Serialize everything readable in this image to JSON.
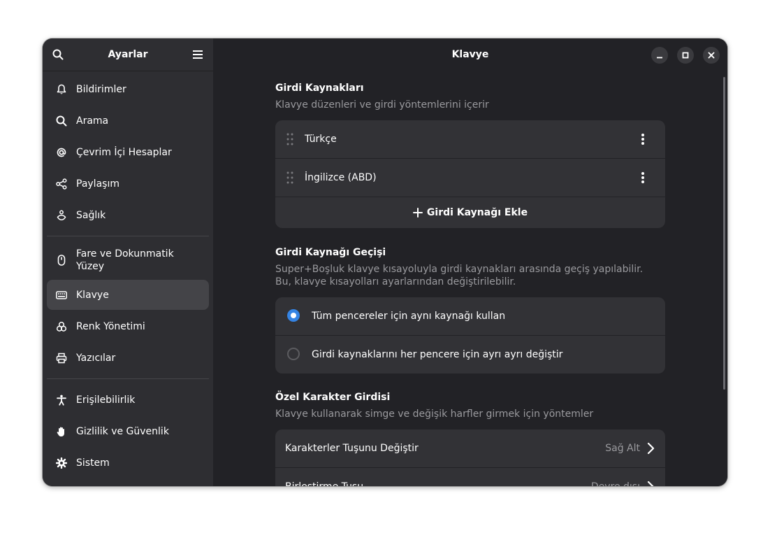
{
  "sidebar": {
    "title": "Ayarlar",
    "items": [
      {
        "label": "Bildirimler"
      },
      {
        "label": "Arama"
      },
      {
        "label": "Çevrim İçi Hesaplar"
      },
      {
        "label": "Paylaşım"
      },
      {
        "label": "Sağlık"
      },
      {
        "label": "Fare ve Dokunmatik Yüzey"
      },
      {
        "label": "Klavye"
      },
      {
        "label": "Renk Yönetimi"
      },
      {
        "label": "Yazıcılar"
      },
      {
        "label": "Erişilebilirlik"
      },
      {
        "label": "Gizlilik ve Güvenlik"
      },
      {
        "label": "Sistem"
      }
    ]
  },
  "main": {
    "title": "Klavye",
    "input_sources": {
      "title": "Girdi Kaynakları",
      "description": "Klavye düzenleri ve girdi yöntemlerini içerir",
      "sources": [
        "Türkçe",
        "İngilizce (ABD)"
      ],
      "add_label": "Girdi Kaynağı Ekle"
    },
    "switching": {
      "title": "Girdi Kaynağı Geçişi",
      "description_line1": "Super+Boşluk klavye kısayoluyla girdi kaynakları arasında geçiş yapılabilir.",
      "description_line2": "Bu, klavye kısayolları ayarlarından değiştirilebilir.",
      "options": [
        "Tüm pencereler için aynı kaynağı kullan",
        "Girdi kaynaklarını her pencere için ayrı ayrı değiştir"
      ],
      "selected": 0
    },
    "special_chars": {
      "title": "Özel Karakter Girdisi",
      "description": "Klavye kullanarak simge ve değişik harfler girmek için yöntemler",
      "rows": [
        {
          "label": "Karakterler Tuşunu Değiştir",
          "value": "Sağ Alt"
        },
        {
          "label": "Birleştirme Tuşu",
          "value": "Devre dışı"
        }
      ]
    }
  },
  "colors": {
    "accent": "#3584e4",
    "window_bg": "#222226",
    "sidebar_bg": "#2e2e32",
    "card_bg": "#323236"
  }
}
